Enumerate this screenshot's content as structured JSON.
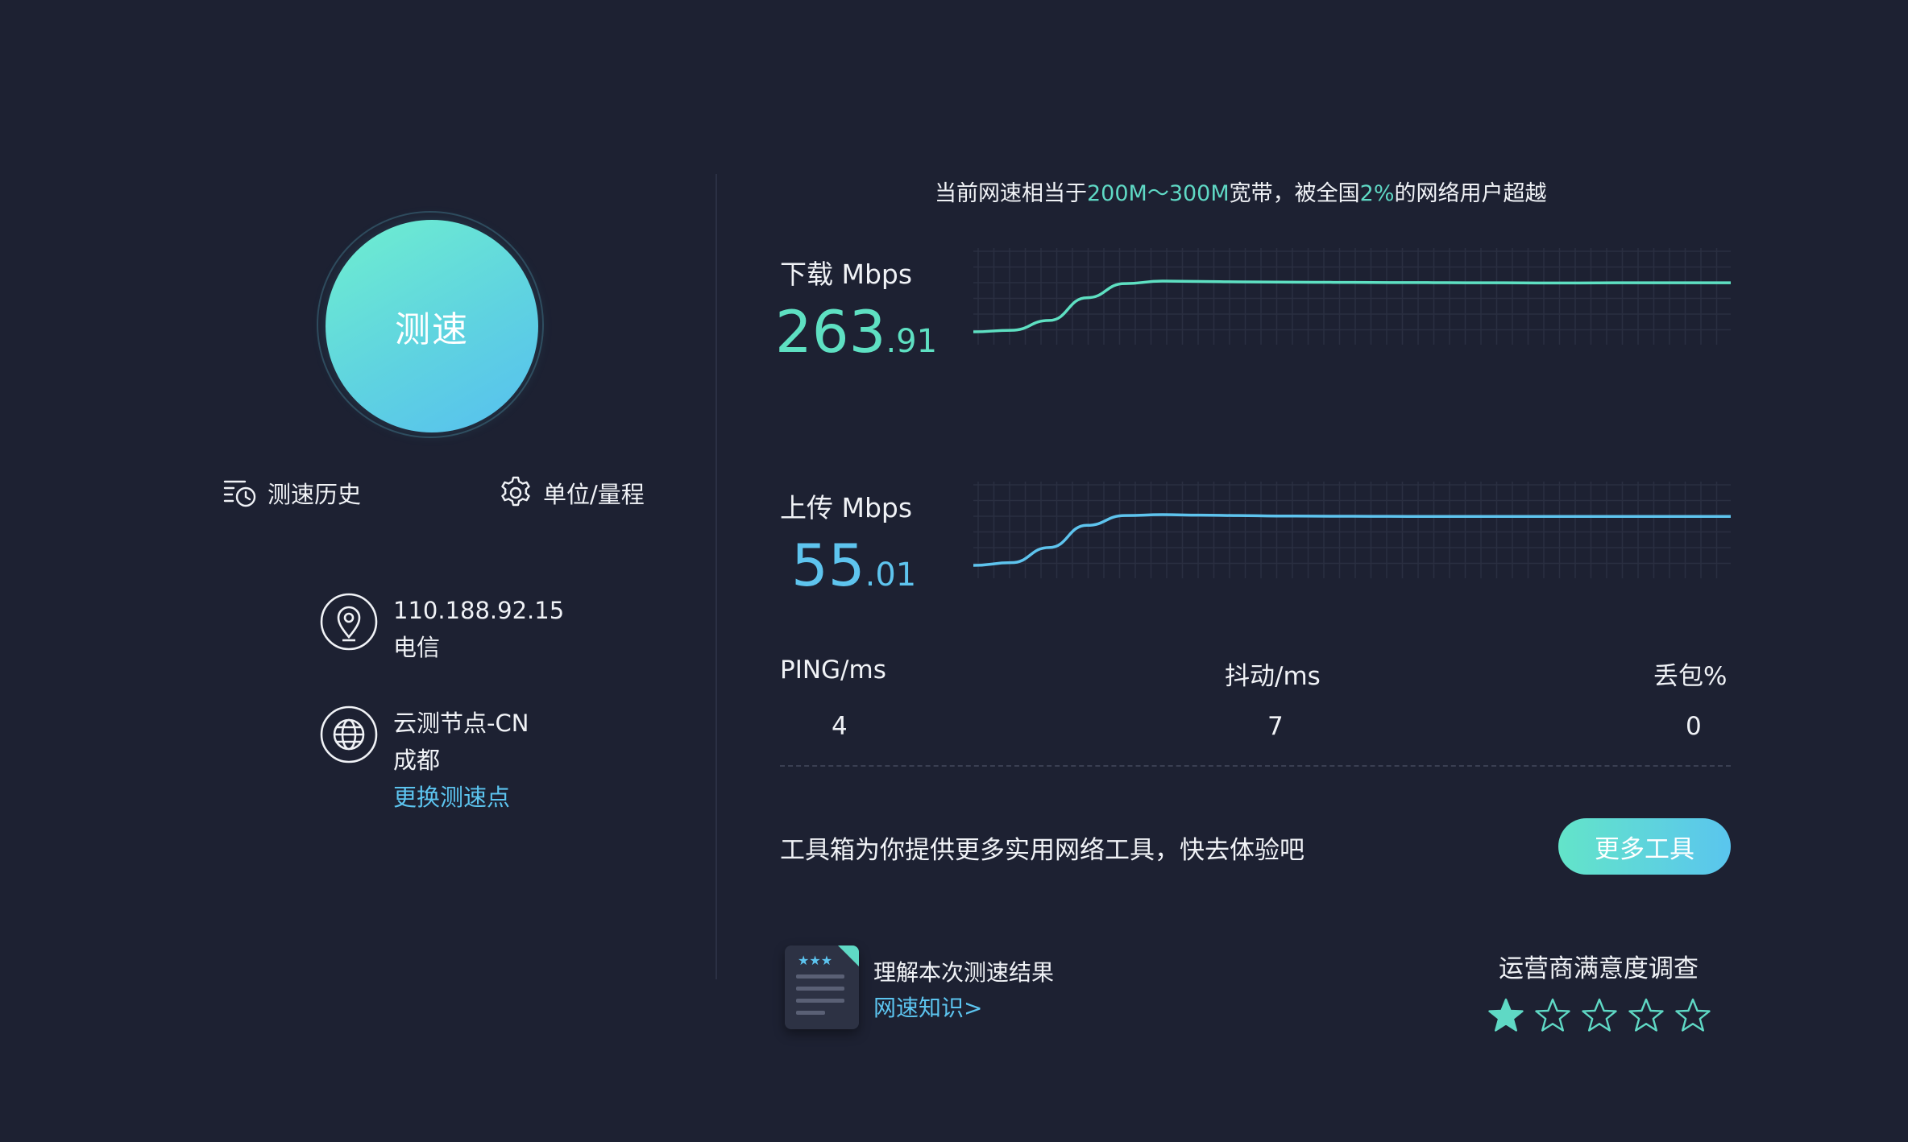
{
  "start": {
    "label": "测速"
  },
  "toolbar": {
    "history_label": "测速历史",
    "units_label": "单位/量程"
  },
  "connection": {
    "ip": "110.188.92.15",
    "isp": "电信"
  },
  "node": {
    "name": "云测节点-CN",
    "city": "成都",
    "change_label": "更换测速点"
  },
  "summary": {
    "prefix": "当前网速相当于",
    "bandwidth": "200M～300M",
    "middle": "宽带，被全国",
    "percent": "2%",
    "suffix": "的网络用户超越"
  },
  "download": {
    "label": "下载 Mbps",
    "int": "263",
    "dec": ".91",
    "color": "#5ee0c2",
    "samples_mbps": [
      0,
      8,
      60,
      180,
      255,
      268,
      266,
      264,
      263,
      262,
      261,
      260,
      260,
      259,
      259,
      258,
      258,
      259,
      259,
      259,
      259
    ]
  },
  "upload": {
    "label": "上传 Mbps",
    "int": "55",
    "dec": ".01",
    "color": "#5ec4ee",
    "samples_mbps": [
      0,
      3,
      20,
      45,
      56,
      57,
      56.5,
      56,
      55.5,
      55.3,
      55.2,
      55.1,
      55,
      55,
      55,
      55,
      55,
      55,
      55,
      55,
      55
    ]
  },
  "stats": {
    "ping": {
      "header": "PING/ms",
      "value": "4"
    },
    "jitter": {
      "header": "抖动/ms",
      "value": "7"
    },
    "loss": {
      "header": "丢包%",
      "value": "0"
    }
  },
  "toolbox": {
    "text": "工具箱为你提供更多实用网络工具，快去体验吧",
    "button_label": "更多工具"
  },
  "knowledge": {
    "title": "理解本次测速结果",
    "link_label": "网速知识>"
  },
  "survey": {
    "title": "运营商满意度调查",
    "rating": 1,
    "max": 5,
    "filled_color": "#5fd9c5",
    "empty_color": "#5fd9c5"
  },
  "icons": {
    "history": "history-clock-icon",
    "settings": "gear-icon",
    "location": "location-pin-icon",
    "globe": "globe-icon",
    "document": "document-icon",
    "star": "star-icon"
  }
}
